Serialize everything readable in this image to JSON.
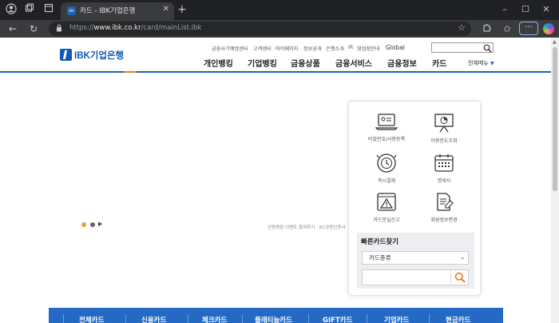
{
  "browser": {
    "tab_title": "카드 - IBK기업은행",
    "tab_favicon": "IBK",
    "url_scheme": "https://",
    "url_host": "www.ibk.co.kr",
    "url_path": "/card/mainList.ibk",
    "accent": "#8ab4f8"
  },
  "site": {
    "logo_text": "IBK기업은행",
    "brand_color": "#0f5ab8",
    "utility_links": [
      "금융사기예방센터",
      "고객센터",
      "마이페이지",
      "정보공개",
      "은행소개",
      "IR",
      "영업점안내",
      "Global"
    ],
    "gnb": [
      "개인뱅킹",
      "기업뱅킹",
      "금융상품",
      "금융서비스",
      "금융정보",
      "카드"
    ],
    "all_menu": "전체메뉴",
    "banner_captions": [
      "신용평점 이벤트 참여하기",
      "EC공동인증서"
    ]
  },
  "quick_panel": {
    "items": [
      {
        "label": "비밀번호/사용등록",
        "icon": "laptop-id-icon"
      },
      {
        "label": "이용한도조회",
        "icon": "chart-board-icon"
      },
      {
        "label": "즉시결제",
        "icon": "instant-pay-icon"
      },
      {
        "label": "명세서",
        "icon": "calendar-icon"
      },
      {
        "label": "카드분실신고",
        "icon": "warning-card-icon"
      },
      {
        "label": "회원정보변경",
        "icon": "document-edit-icon"
      }
    ],
    "find_title": "빠른카드찾기",
    "select_value": "카드종류",
    "search_value": ""
  },
  "card_bar": {
    "items": [
      "전체카드",
      "신용카드",
      "체크카드",
      "플래티늄카드",
      "GIFT카드",
      "기업카드",
      "현금카드"
    ],
    "color": "#2469c3"
  }
}
